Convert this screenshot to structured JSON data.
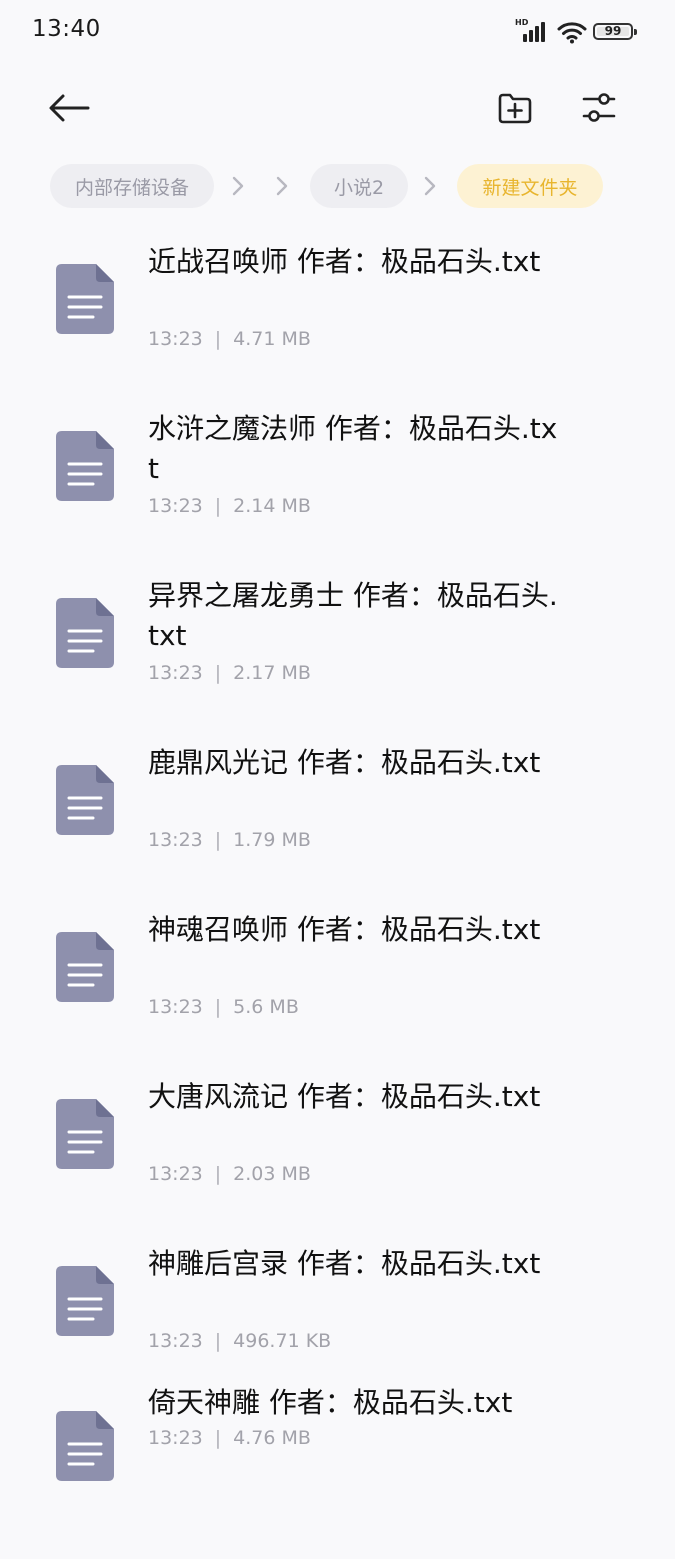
{
  "status_bar": {
    "time": "13:40",
    "network_label": "HD",
    "battery": "99",
    "signal_icon": "cellular-signal-icon",
    "wifi_icon": "wifi-icon",
    "battery_icon": "battery-icon"
  },
  "toolbar": {
    "back_icon": "arrow-left-icon",
    "new_folder_icon": "folder-plus-icon",
    "filter_icon": "sliders-icon"
  },
  "breadcrumb": {
    "items": [
      "内部存储设备",
      "小说2",
      "新建文件夹"
    ],
    "separator_icon": "chevron-right-icon",
    "active_color": "#e8b52e"
  },
  "files": [
    {
      "name": "近战召唤师 作者：极品石头.txt",
      "time": "13:23",
      "separator": "|",
      "size": "4.71 MB"
    },
    {
      "name": "水浒之魔法师 作者：极品石头.txt",
      "time": "13:23",
      "separator": "|",
      "size": "2.14 MB"
    },
    {
      "name": "异界之屠龙勇士 作者：极品石头.txt",
      "time": "13:23",
      "separator": "|",
      "size": "2.17 MB"
    },
    {
      "name": "鹿鼎风光记 作者：极品石头.txt",
      "time": "13:23",
      "separator": "|",
      "size": "1.79 MB"
    },
    {
      "name": "神魂召唤师 作者：极品石头.txt",
      "time": "13:23",
      "separator": "|",
      "size": "5.6 MB"
    },
    {
      "name": "大唐风流记 作者：极品石头.txt",
      "time": "13:23",
      "separator": "|",
      "size": "2.03 MB"
    },
    {
      "name": "神雕后宫录 作者：极品石头.txt",
      "time": "13:23",
      "separator": "|",
      "size": "496.71 KB"
    },
    {
      "name": "倚天神雕 作者：极品石头.txt",
      "time": "13:23",
      "separator": "|",
      "size": "4.76 MB"
    }
  ],
  "file_icon": "document-icon",
  "colors": {
    "file_icon": "#8e90ad",
    "meta_text": "#a2a2aa"
  }
}
